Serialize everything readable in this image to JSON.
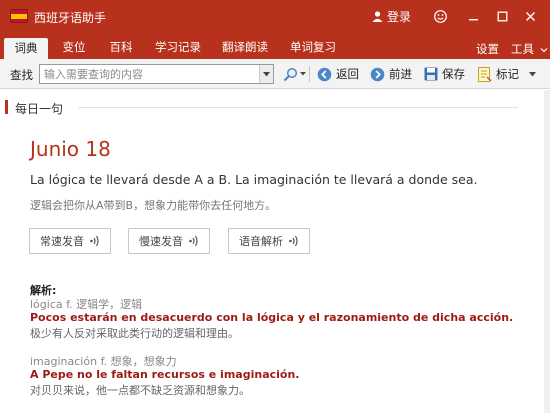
{
  "app": {
    "title": "西班牙语助手",
    "login": "登录"
  },
  "tabs": [
    "词典",
    "变位",
    "百科",
    "学习记录",
    "翻译朗读",
    "单词复习"
  ],
  "menu_right": {
    "settings": "设置",
    "tools": "工具"
  },
  "toolbar": {
    "find_label": "查找",
    "search_placeholder": "输入需要查询的内容",
    "back": "返回",
    "forward": "前进",
    "save": "保存",
    "mark": "标记"
  },
  "daily": {
    "section_title": "每日一句",
    "date": "Junio 18",
    "sentence": "La lógica te llevará desde A a B. La imaginación te llevará a donde sea.",
    "translation": "逻辑会把你从A带到B，想象力能带你去任何地方。",
    "buttons": [
      "常速发音",
      "慢速发音",
      "语音解析"
    ]
  },
  "analysis": {
    "label": "解析:",
    "items": [
      {
        "word": "lógica f. 逻辑学，逻辑",
        "example": "Pocos estarán en desacuerdo con la lógica y el razonamiento de dicha acción.",
        "example_translation": "极少有人反对采取此类行动的逻辑和理由。"
      },
      {
        "word": "imaginación f. 想象，想象力",
        "example": "A Pepe no le faltan recursos e imaginación.",
        "example_translation": "对贝贝来说，他一点都不缺乏资源和想象力。"
      }
    ]
  },
  "colors": {
    "brand": "#b8311c",
    "example_red": "#9c1a14"
  }
}
